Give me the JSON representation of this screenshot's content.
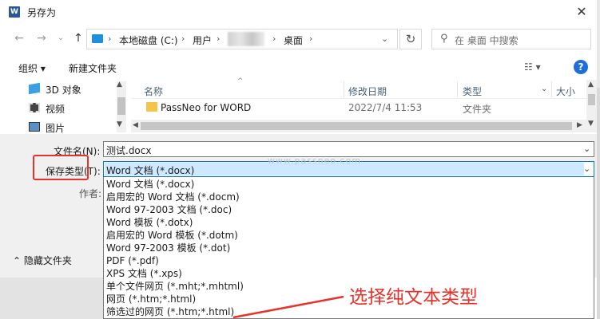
{
  "window": {
    "title": "另存为",
    "app_icon_letter": "W"
  },
  "nav": {
    "breadcrumbs": [
      "本地磁盘 (C:)",
      "用户",
      "桌面"
    ],
    "search_placeholder": "在 桌面 中搜索"
  },
  "toolbar": {
    "organize": "组织 ▾",
    "new_folder": "新建文件夹"
  },
  "navpane": {
    "items": [
      "3D 对象",
      "视频",
      "图片"
    ]
  },
  "filelist": {
    "columns": [
      "名称",
      "修改日期",
      "类型",
      "大小"
    ],
    "rows": [
      {
        "name": "PassNeo for WORD",
        "date": "2022/7/4 11:53",
        "type": "文件夹"
      }
    ]
  },
  "form": {
    "filename_label": "文件名(N):",
    "filename_value": "测试.docx",
    "savetype_label": "保存类型(T):",
    "savetype_value": "Word 文档 (*.docx)",
    "author_label": "作者:",
    "hide_folders": "隐藏文件夹"
  },
  "dropdown_options": [
    "Word 文档 (*.docx)",
    "启用宏的 Word 文档 (*.docm)",
    "Word 97-2003 文档 (*.doc)",
    "Word 模板 (*.dotx)",
    "启用宏的 Word 模板 (*.dotm)",
    "Word 97-2003 模板 (*.dot)",
    "PDF (*.pdf)",
    "XPS 文档 (*.xps)",
    "单个文件网页 (*.mht;*.mhtml)",
    "网页 (*.htm;*.html)",
    "筛选过的网页 (*.htm;*.html)"
  ],
  "watermark": "www.passneo.com",
  "annotation": "选择纯文本类型",
  "colors": {
    "accent": "#0078d7",
    "annotation_red": "#e8312a",
    "folder": "#f3c54a"
  }
}
